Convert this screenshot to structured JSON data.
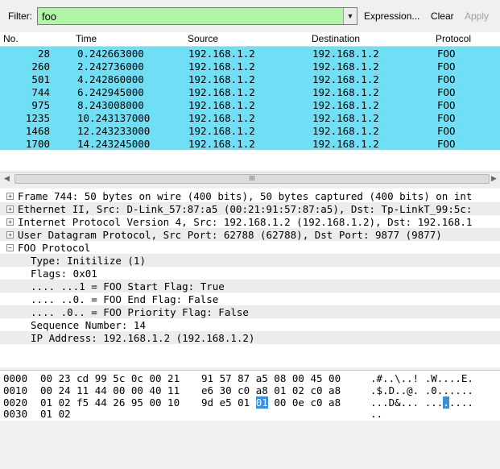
{
  "filter": {
    "label": "Filter:",
    "value": "foo",
    "expression_label": "Expression...",
    "clear_label": "Clear",
    "apply_label": "Apply"
  },
  "packet_list": {
    "columns": [
      "No.",
      "Time",
      "Source",
      "Destination",
      "Protocol"
    ],
    "row_color": "#6fdff5",
    "rows": [
      {
        "no": "28",
        "time": "0.242663000",
        "src": "192.168.1.2",
        "dst": "192.168.1.2",
        "proto": "FOO"
      },
      {
        "no": "260",
        "time": "2.242736000",
        "src": "192.168.1.2",
        "dst": "192.168.1.2",
        "proto": "FOO"
      },
      {
        "no": "501",
        "time": "4.242860000",
        "src": "192.168.1.2",
        "dst": "192.168.1.2",
        "proto": "FOO"
      },
      {
        "no": "744",
        "time": "6.242945000",
        "src": "192.168.1.2",
        "dst": "192.168.1.2",
        "proto": "FOO"
      },
      {
        "no": "975",
        "time": "8.243008000",
        "src": "192.168.1.2",
        "dst": "192.168.1.2",
        "proto": "FOO"
      },
      {
        "no": "1235",
        "time": "10.243137000",
        "src": "192.168.1.2",
        "dst": "192.168.1.2",
        "proto": "FOO"
      },
      {
        "no": "1468",
        "time": "12.243233000",
        "src": "192.168.1.2",
        "dst": "192.168.1.2",
        "proto": "FOO"
      },
      {
        "no": "1700",
        "time": "14.243245000",
        "src": "192.168.1.2",
        "dst": "192.168.1.2",
        "proto": "FOO"
      }
    ],
    "scroll_grip": "III"
  },
  "details": {
    "lines": [
      {
        "text": "Frame 744: 50 bytes on wire (400 bits), 50 bytes captured (400 bits) on int",
        "expander": "+"
      },
      {
        "text": "Ethernet II, Src: D-Link_57:87:a5 (00:21:91:57:87:a5), Dst: Tp-LinkT_99:5c:",
        "expander": "+"
      },
      {
        "text": "Internet Protocol Version 4, Src: 192.168.1.2 (192.168.1.2), Dst: 192.168.1",
        "expander": "+"
      },
      {
        "text": "User Datagram Protocol, Src Port: 62788 (62788), Dst Port: 9877 (9877)",
        "expander": "+"
      },
      {
        "text": "FOO Protocol",
        "expander": "−"
      },
      {
        "text": "Type: Initilize (1)",
        "expander": ""
      },
      {
        "text": "Flags: 0x01",
        "expander": ""
      },
      {
        "text": ".... ...1 = FOO Start Flag: True",
        "expander": ""
      },
      {
        "text": ".... ..0. = FOO End Flag: False",
        "expander": ""
      },
      {
        "text": ".... .0.. = FOO Priority Flag: False",
        "expander": ""
      },
      {
        "text": "Sequence Number: 14",
        "expander": ""
      },
      {
        "text": "IP Address: 192.168.1.2 (192.168.1.2)",
        "expander": ""
      }
    ]
  },
  "hex": {
    "rows": [
      {
        "offset": "0000",
        "bytes_a": "00 23 cd 99 5c 0c 00 21",
        "bytes_b": "91 57 87 a5 08 00 45 00",
        "ascii": ".#..\\..! .W....E."
      },
      {
        "offset": "0010",
        "bytes_a": "00 24 11 44 00 00 40 11",
        "bytes_b": "e6 30 c0 a8 01 02 c0 a8",
        "ascii": ".$.D..@. .0......"
      },
      {
        "offset": "0020",
        "bytes_a": "01 02 f5 44 26 95 00 10",
        "bytes_b_pre": "9d e5 01 ",
        "bytes_b_hl": "01",
        "bytes_b_post": " 00 0e c0 a8",
        "ascii_pre": "...D&... ...",
        "ascii_hl": ".",
        "ascii_post": "...."
      },
      {
        "offset": "0030",
        "bytes_a": "01 02",
        "bytes_b": "",
        "ascii": ".."
      }
    ],
    "highlight_color": "#3c8fd6"
  }
}
